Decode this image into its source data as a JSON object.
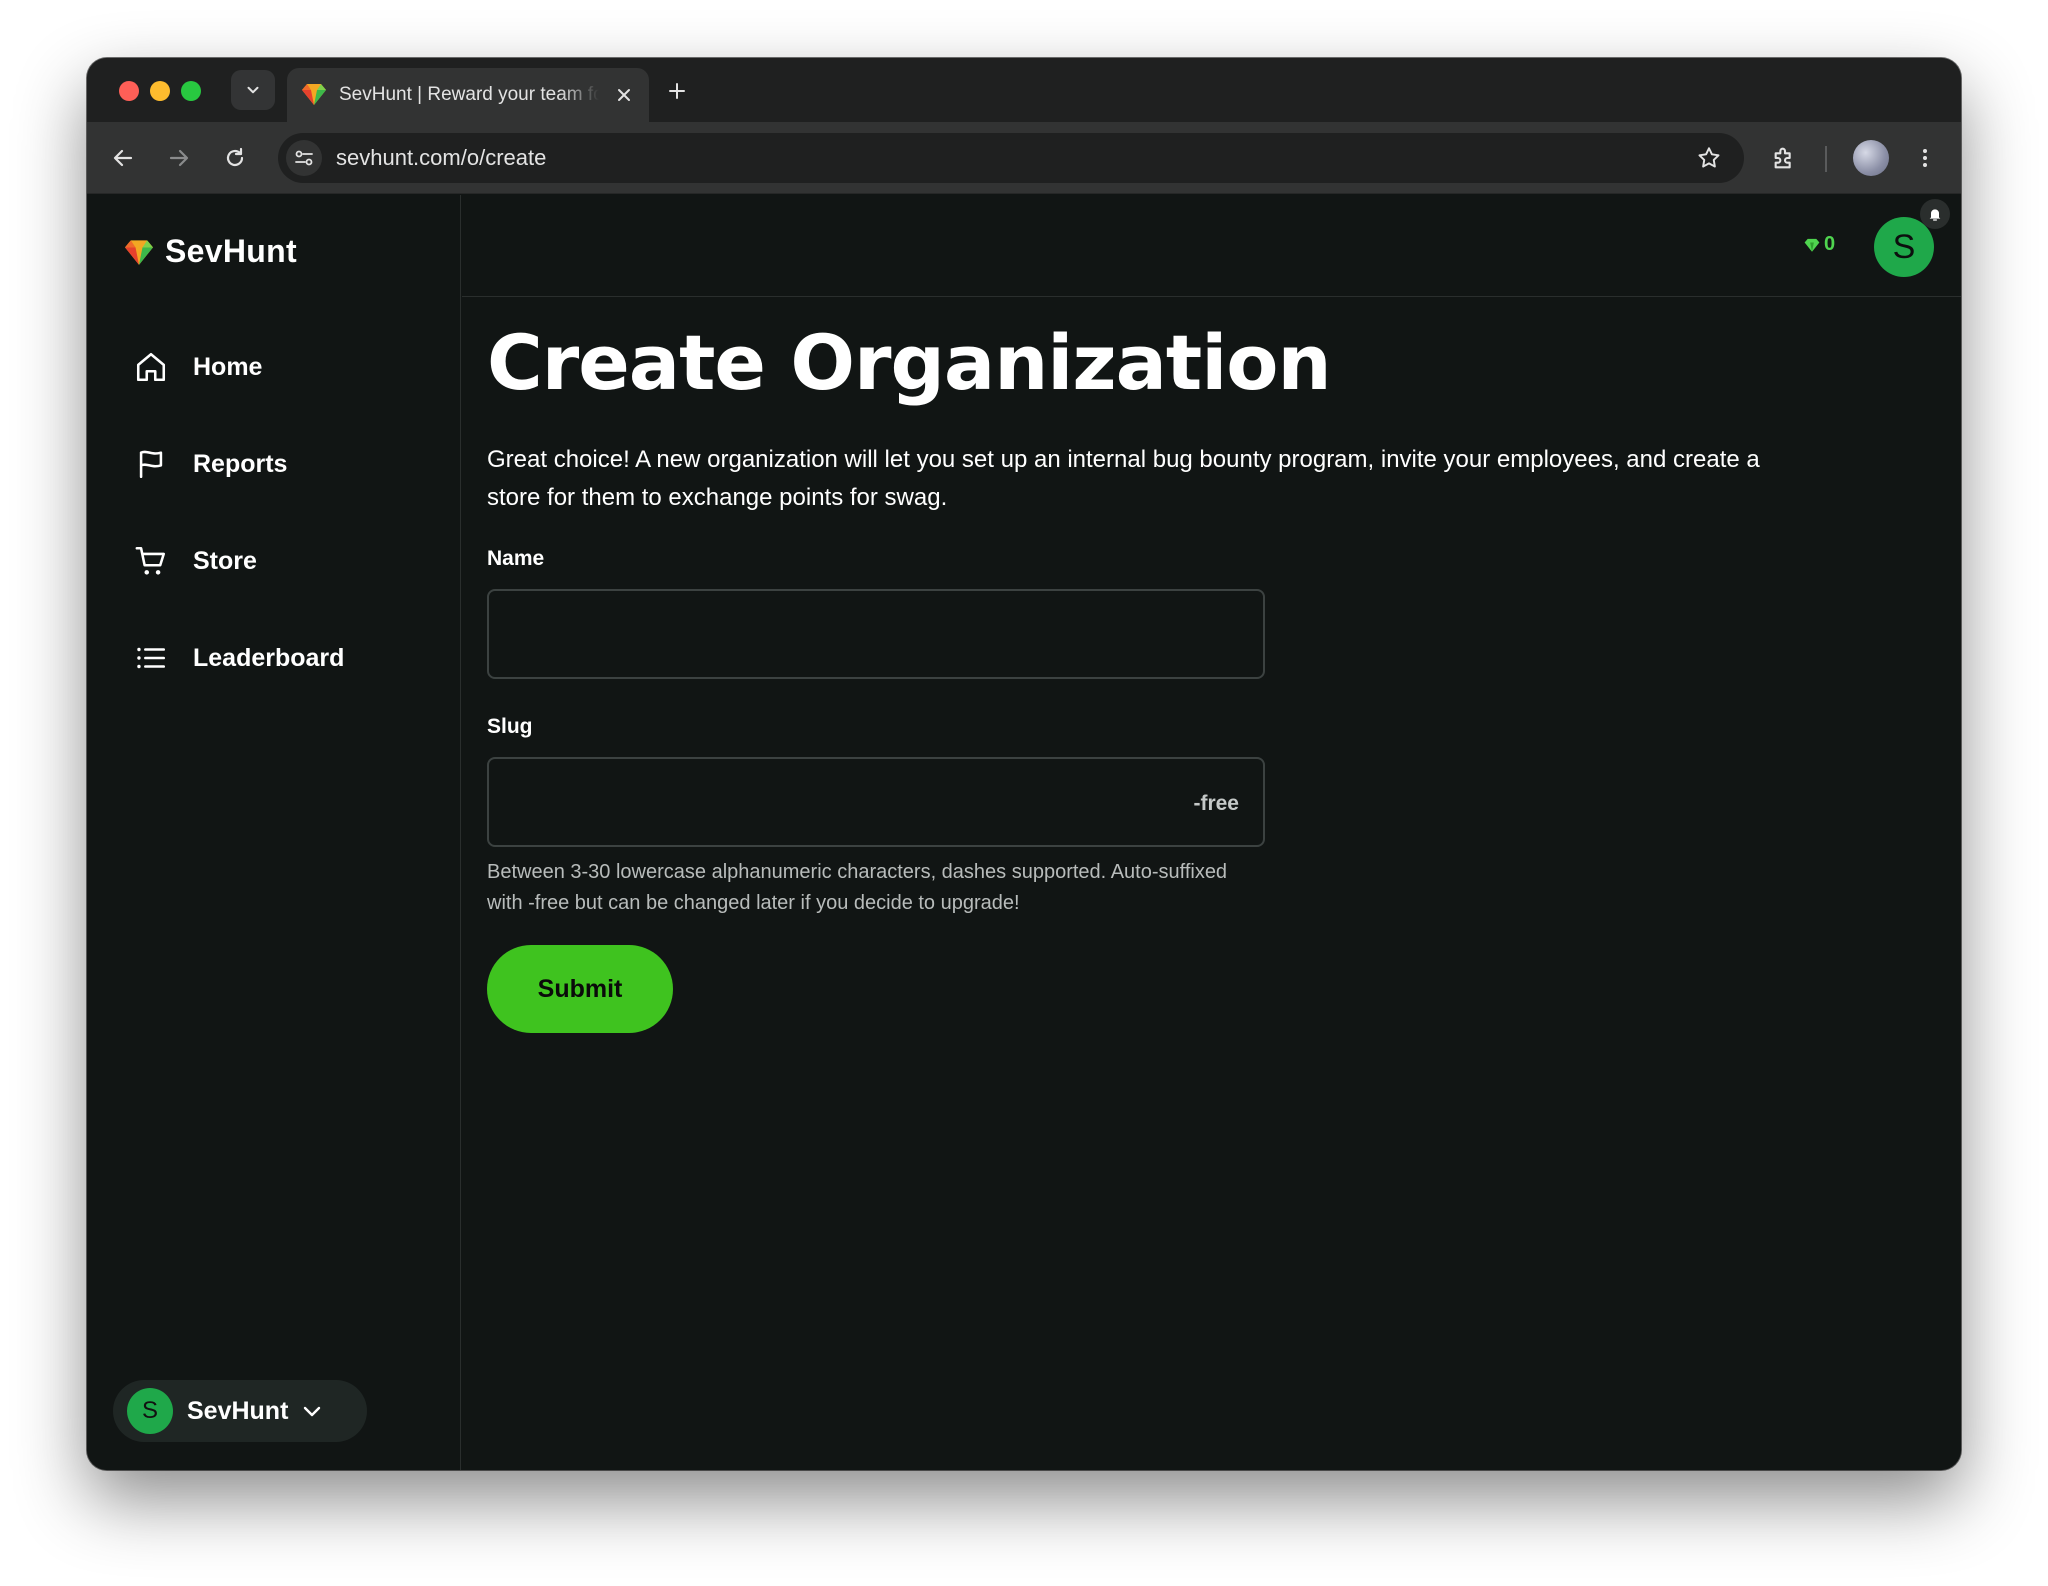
{
  "browser": {
    "tab_title": "SevHunt | Reward your team for finding bugs",
    "url": "sevhunt.com/o/create"
  },
  "app": {
    "logo_text": "SevHunt",
    "points": "0",
    "user_initial": "S"
  },
  "sidebar": {
    "items": [
      {
        "label": "Home",
        "icon": "home-icon"
      },
      {
        "label": "Reports",
        "icon": "flag-icon"
      },
      {
        "label": "Store",
        "icon": "cart-icon"
      },
      {
        "label": "Leaderboard",
        "icon": "list-icon"
      }
    ],
    "org": {
      "initial": "S",
      "name": "SevHunt"
    }
  },
  "page": {
    "title": "Create Organization",
    "intro": "Great choice! A new organization will let you set up an internal bug bounty program, invite your employees, and create a store for them to exchange points for swag.",
    "name_label": "Name",
    "name_value": "",
    "slug_label": "Slug",
    "slug_value": "",
    "slug_suffix": "-free",
    "slug_help": "Between 3-30 lowercase alphanumeric characters, dashes supported. Auto-suffixed with -free but can be changed later if you decide to upgrade!",
    "submit_label": "Submit"
  },
  "colors": {
    "accent_green": "#3fc31f",
    "avatar_green": "#1fa84a",
    "background": "#111514"
  }
}
